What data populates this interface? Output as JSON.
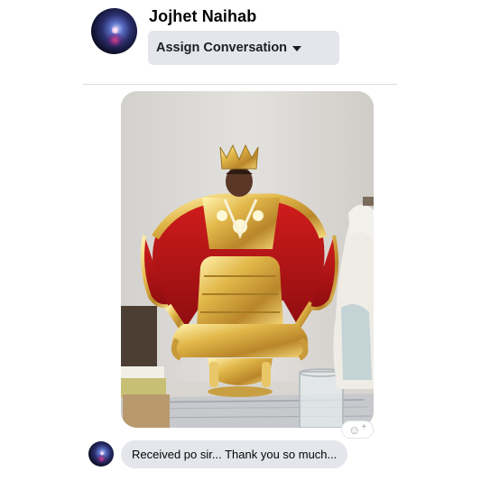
{
  "header": {
    "contact_name": "Jojhet Naihab",
    "assign_label": "Assign Conversation"
  },
  "conversation": {
    "message_text": "Received po sir... Thank you so much...",
    "reaction_icon": "smiley-add-icon"
  },
  "colors": {
    "button_bg": "#e4e6eb",
    "bubble_bg": "#e4e6eb",
    "text": "#050505"
  }
}
